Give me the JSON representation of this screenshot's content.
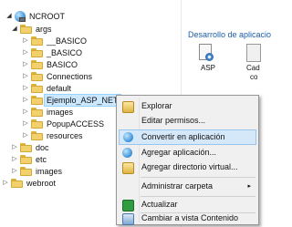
{
  "tree": {
    "root": "NCROOT",
    "items": [
      {
        "label": "args"
      },
      {
        "label": "__BASICO"
      },
      {
        "label": "_BASICO"
      },
      {
        "label": "BASICO"
      },
      {
        "label": "Connections"
      },
      {
        "label": "default"
      },
      {
        "label": "Ejemplo_ASP_NET"
      },
      {
        "label": "images"
      },
      {
        "label": "PopupACCESS"
      },
      {
        "label": "resources"
      },
      {
        "label": "doc"
      },
      {
        "label": "etc"
      },
      {
        "label": "images"
      },
      {
        "label": "webroot"
      }
    ]
  },
  "right_panel": {
    "section_title": "Desarrollo de aplicacio",
    "icons": [
      {
        "label": "ASP"
      },
      {
        "label": "Cad"
      },
      {
        "label": "co"
      }
    ]
  },
  "context_menu": {
    "items": [
      {
        "label": "Explorar",
        "icon": "explore-icon"
      },
      {
        "label": "Editar permisos...",
        "icon": ""
      },
      {
        "label": "Convertir en aplicación",
        "icon": "convert-app-icon"
      },
      {
        "label": "Agregar aplicación...",
        "icon": "add-app-icon"
      },
      {
        "label": "Agregar directorio virtual...",
        "icon": "add-virtual-dir-icon"
      },
      {
        "label": "Administrar carpeta",
        "icon": "",
        "submenu": "▸"
      },
      {
        "label": "Actualizar",
        "icon": "refresh-icon"
      },
      {
        "label": "Cambiar a vista Contenido",
        "icon": "content-view-icon"
      }
    ]
  },
  "colors": {
    "selection": "#cce8ff",
    "menu_hover": "#d5e8fa",
    "link_blue": "#1a5ea8",
    "folder": "#f2d06b"
  }
}
